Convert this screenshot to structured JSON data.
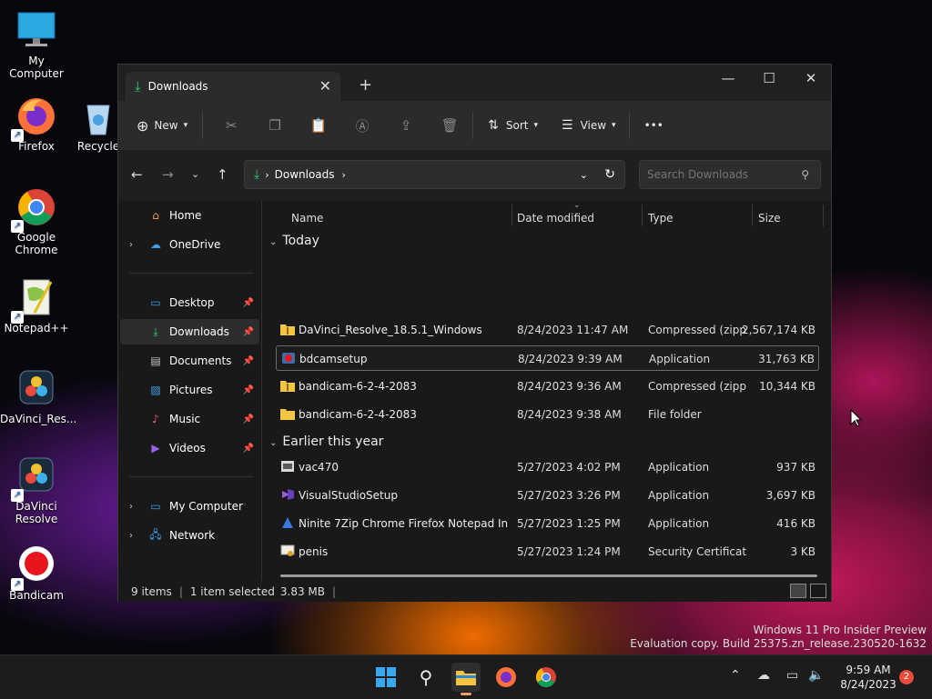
{
  "desktop": {
    "icons": [
      {
        "label": "My Computer"
      },
      {
        "label": "Firefox"
      },
      {
        "label": "Recycle"
      },
      {
        "label": "Google Chrome"
      },
      {
        "label": "Notepad++"
      },
      {
        "label": "DaVinci_Res..."
      },
      {
        "label": "DaVinci Resolve"
      },
      {
        "label": "Bandicam"
      }
    ]
  },
  "window": {
    "tab_title": "Downloads",
    "toolbar": {
      "new_label": "New",
      "sort_label": "Sort",
      "view_label": "View",
      "more_label": "•••"
    },
    "address": {
      "path": "Downloads",
      "search_placeholder": "Search Downloads"
    },
    "sidebar": {
      "home": "Home",
      "onedrive": "OneDrive",
      "desktop": "Desktop",
      "downloads": "Downloads",
      "documents": "Documents",
      "pictures": "Pictures",
      "music": "Music",
      "videos": "Videos",
      "mycomputer": "My Computer",
      "network": "Network"
    },
    "columns": {
      "name": "Name",
      "date": "Date modified",
      "type": "Type",
      "size": "Size"
    },
    "groups": {
      "today": "Today",
      "earlier": "Earlier this year"
    },
    "files": [
      {
        "name": "DaVinci_Resolve_18.5.1_Windows",
        "date": "8/24/2023 11:47 AM",
        "type": "Compressed (zipp...",
        "size": "2,567,174 KB"
      },
      {
        "name": "bdcamsetup",
        "date": "8/24/2023 9:39 AM",
        "type": "Application",
        "size": "31,763 KB"
      },
      {
        "name": "bandicam-6-2-4-2083",
        "date": "8/24/2023 9:36 AM",
        "type": "Compressed (zipp...",
        "size": "10,344 KB"
      },
      {
        "name": "bandicam-6-2-4-2083",
        "date": "8/24/2023 9:38 AM",
        "type": "File folder",
        "size": ""
      },
      {
        "name": "vac470",
        "date": "5/27/2023 4:02 PM",
        "type": "Application",
        "size": "937 KB"
      },
      {
        "name": "VisualStudioSetup",
        "date": "5/27/2023 3:26 PM",
        "type": "Application",
        "size": "3,697 KB"
      },
      {
        "name": "Ninite 7Zip Chrome Firefox Notepad Inst...",
        "date": "5/27/2023 1:25 PM",
        "type": "Application",
        "size": "416 KB"
      },
      {
        "name": "penis",
        "date": "5/27/2023 1:24 PM",
        "type": "Security Certificate",
        "size": "3 KB"
      }
    ],
    "status": {
      "count": "9 items",
      "selected": "1 item selected",
      "selsize": "3.83 MB"
    }
  },
  "watermark": {
    "line1": "Windows 11 Pro Insider Preview",
    "line2": "Evaluation copy. Build 25375.zn_release.230520-1632"
  },
  "taskbar": {
    "time": "9:59 AM",
    "date": "8/24/2023",
    "badge": "2"
  },
  "colors": {
    "accent": "#0078d4",
    "folder": "#f4c542",
    "download_green": "#2ecc71"
  }
}
